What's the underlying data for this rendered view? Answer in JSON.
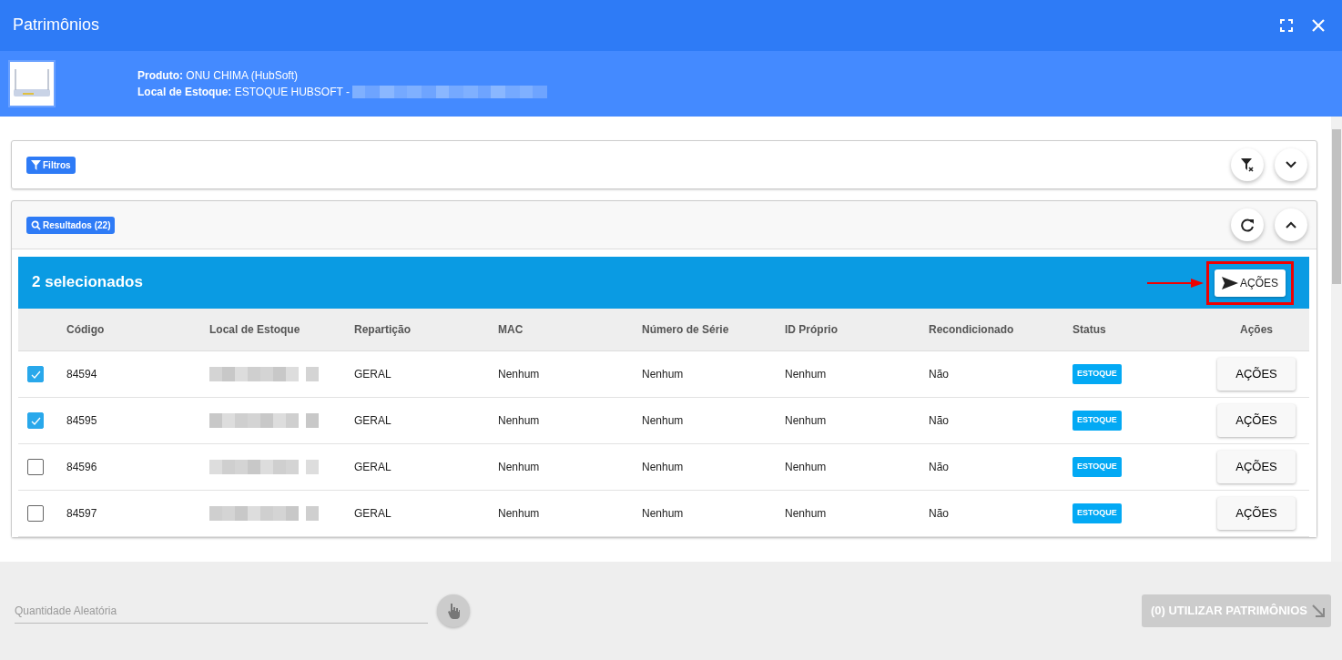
{
  "window": {
    "title": "Patrimônios"
  },
  "product": {
    "label": "Produto:",
    "value": "ONU CHIMA (HubSoft)"
  },
  "stock": {
    "label": "Local de Estoque:",
    "value": "ESTOQUE HUBSOFT -"
  },
  "filters": {
    "label": "Filtros"
  },
  "results": {
    "label": "Resultados (22)"
  },
  "selection": {
    "text": "2 selecionados",
    "action": "AÇÕES"
  },
  "table": {
    "columns": [
      "Código",
      "Local de Estoque",
      "Repartição",
      "MAC",
      "Número de Série",
      "ID Próprio",
      "Recondicionado",
      "Status",
      "Ações"
    ],
    "rows": [
      {
        "selected": true,
        "code": "84594",
        "division": "GERAL",
        "mac": "Nenhum",
        "serial": "Nenhum",
        "own_id": "Nenhum",
        "refurbished": "Não",
        "status": "ESTOQUE",
        "action": "AÇÕES"
      },
      {
        "selected": true,
        "code": "84595",
        "division": "GERAL",
        "mac": "Nenhum",
        "serial": "Nenhum",
        "own_id": "Nenhum",
        "refurbished": "Não",
        "status": "ESTOQUE",
        "action": "AÇÕES"
      },
      {
        "selected": false,
        "code": "84596",
        "division": "GERAL",
        "mac": "Nenhum",
        "serial": "Nenhum",
        "own_id": "Nenhum",
        "refurbished": "Não",
        "status": "ESTOQUE",
        "action": "AÇÕES"
      },
      {
        "selected": false,
        "code": "84597",
        "division": "GERAL",
        "mac": "Nenhum",
        "serial": "Nenhum",
        "own_id": "Nenhum",
        "refurbished": "Não",
        "status": "ESTOQUE",
        "action": "AÇÕES"
      }
    ]
  },
  "footer": {
    "random_quantity": {
      "placeholder": "Quantidade Aleatória"
    },
    "use_button": {
      "label": "(0) UTILIZAR PATRIMÔNIOS",
      "disabled": true
    }
  }
}
